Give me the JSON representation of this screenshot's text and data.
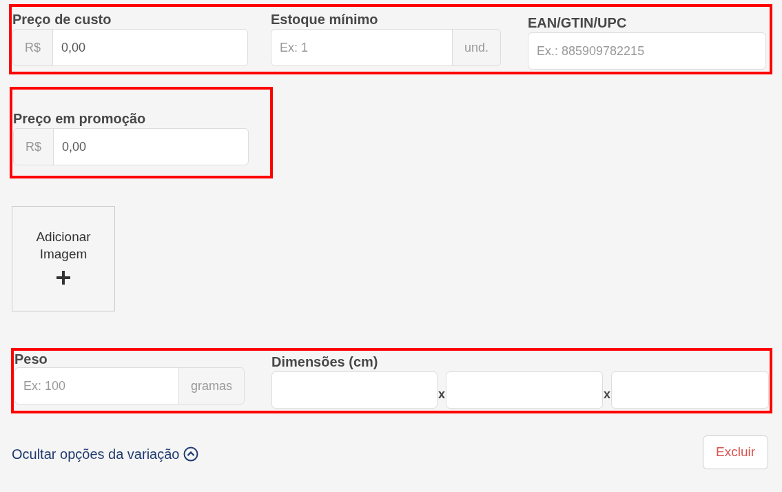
{
  "fields": [
    {
      "label": "Preço de custo",
      "prefix": "R$",
      "value": "0,00"
    },
    {
      "label": "Estoque mínimo",
      "placeholder": "Ex: 1",
      "suffix": "und."
    },
    {
      "label": "EAN/GTIN/UPC",
      "placeholder": "Ex.: 885909782215"
    }
  ],
  "promo_field": {
    "label": "Preço em promoção",
    "prefix": "R$",
    "value": "0,00"
  },
  "image_upload": {
    "label": "Adicionar Imagem"
  },
  "weight": {
    "label": "Peso",
    "placeholder": "Ex: 100",
    "suffix": "gramas"
  },
  "dimensions": {
    "label": "Dimensões (cm)",
    "separators": [
      "x",
      "x"
    ]
  },
  "toggle_link": "Ocultar opções da variação",
  "delete_button": "Excluir"
}
